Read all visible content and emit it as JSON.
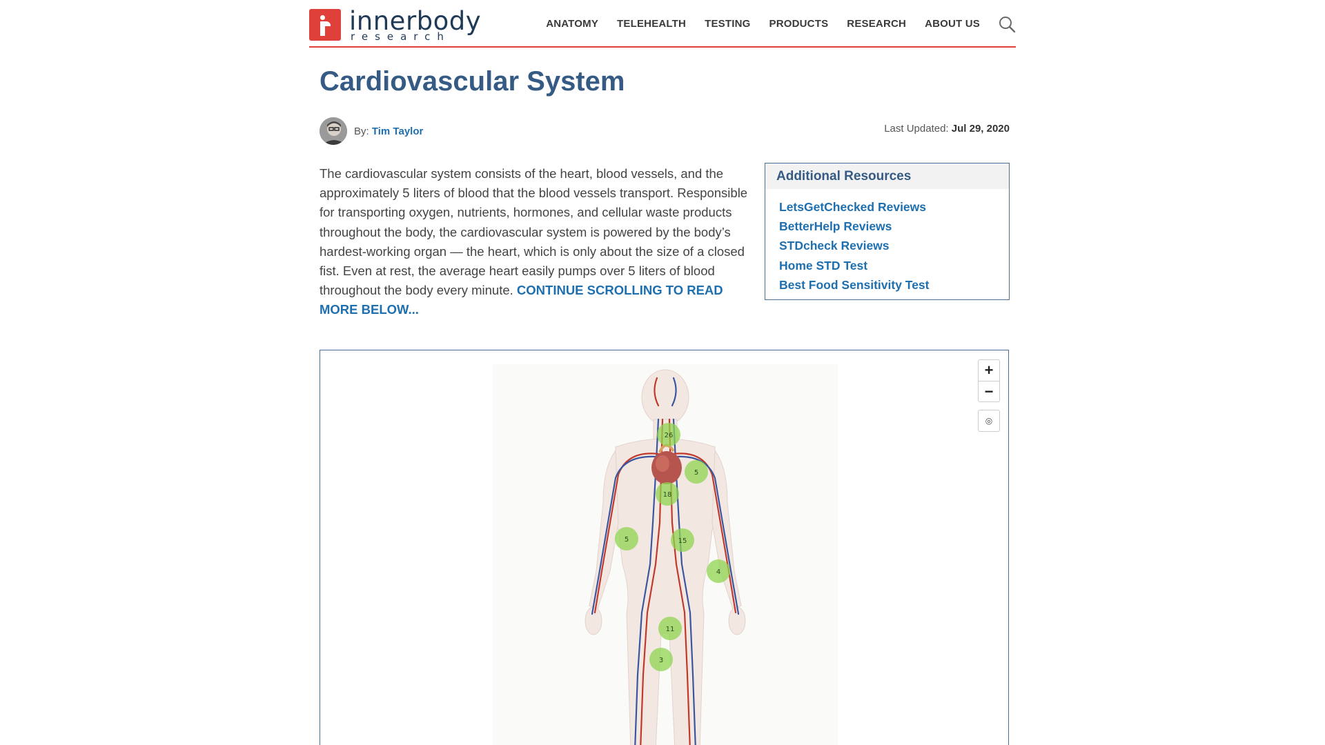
{
  "brand": {
    "name": "innerbody",
    "sub": "research"
  },
  "nav": {
    "items": [
      "ANATOMY",
      "TELEHEALTH",
      "TESTING",
      "PRODUCTS",
      "RESEARCH",
      "ABOUT US"
    ],
    "search_icon": "search-icon"
  },
  "article": {
    "title": "Cardiovascular System",
    "by_label": "By:",
    "author": "Tim Taylor",
    "updated_label": "Last Updated:",
    "updated_date": "Jul 29, 2020",
    "intro": "The cardiovascular system consists of the heart, blood vessels, and the approximately 5 liters of blood that the blood vessels transport. Responsible for transporting oxygen, nutrients, hormones, and cellular waste products throughout the body, the cardiovascular system is powered by the body’s hardest-working organ — the heart, which is only about the size of a closed fist. Even at rest, the average heart easily pumps over 5 liters of blood throughout the body every minute. ",
    "continue_link": "CONTINUE SCROLLING TO READ MORE BELOW..."
  },
  "resources": {
    "heading": "Additional Resources",
    "links": [
      "LetsGetChecked Reviews",
      "BetterHelp Reviews",
      "STDcheck Reviews",
      "Home STD Test",
      "Best Food Sensitivity Test"
    ]
  },
  "viewer": {
    "zoom_in": "+",
    "zoom_out": "−",
    "reset_icon": "◎",
    "hotspots": [
      "26",
      "5",
      "18",
      "5",
      "15",
      "4",
      "11",
      "3"
    ]
  },
  "colors": {
    "brand_red": "#e0403a",
    "title_blue": "#355b85",
    "link_blue": "#1e6fb0",
    "hotspot_green": "#8fd44f"
  }
}
